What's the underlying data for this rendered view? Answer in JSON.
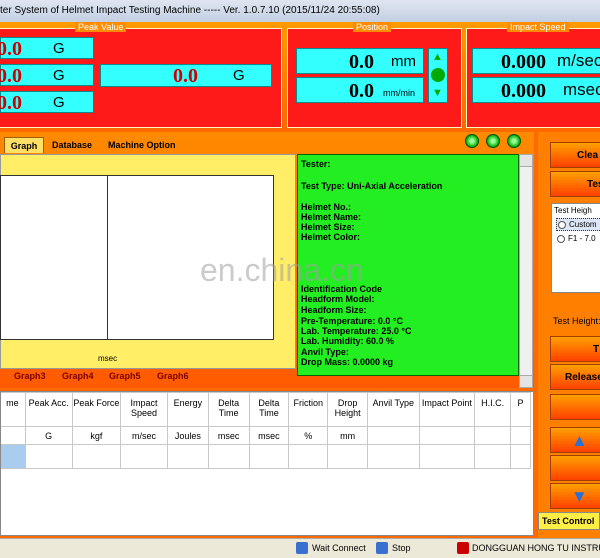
{
  "window": {
    "title": "ter System of Helmet Impact Testing Machine ----- Ver. 1.0.7.10 (2015/11/24 20:55:08)"
  },
  "peak": {
    "label": "Peak Value",
    "rows": [
      {
        "value": "0.0",
        "unit": "G"
      },
      {
        "value": "0.0",
        "unit": "G"
      },
      {
        "value": "0.0",
        "unit": "G"
      }
    ],
    "main": {
      "value": "0.0",
      "unit": "G"
    }
  },
  "position": {
    "label": "Position",
    "pos": {
      "value": "0.0",
      "unit": "mm"
    },
    "speed": {
      "value": "0.0",
      "unit": "mm/min"
    }
  },
  "impact_speed": {
    "label": "Impact Speed",
    "speed": {
      "value": "0.000",
      "unit": "m/sec"
    },
    "time": {
      "value": "0.000",
      "unit": "msec"
    }
  },
  "tabs": [
    "Graph",
    "Database",
    "Machine Option"
  ],
  "graph": {
    "xlabel": "msec"
  },
  "graph_tabs": [
    "Graph3",
    "Graph4",
    "Graph5",
    "Graph6"
  ],
  "info": {
    "lines": [
      "Tester:",
      "Test Type: Uni-Axial Acceleration",
      "Helmet No.:",
      "Helmet Name:",
      "Helmet Size:",
      "Helmet Color:",
      "Identification Code",
      "Headform Model:",
      "Headform Size:",
      "Pre-Temperature: 0.0 °C",
      "Lab. Temperature: 25.0 °C",
      "Lab. Humidity: 60.0 %",
      "Anvil Type:",
      "Drop Mass: 0.0000 kg"
    ]
  },
  "table": {
    "headers": [
      "me",
      "Peak Acc.",
      "Peak Force",
      "Impact Speed",
      "Energy",
      "Delta Time",
      "Delta Time",
      "Friction",
      "Drop Height",
      "Anvil Type",
      "Impact Point",
      "H.I.C.",
      "P"
    ],
    "units": [
      "",
      "G",
      "kgf",
      "m/sec",
      "Joules",
      "msec",
      "msec",
      "%",
      "mm",
      "",
      "",
      "",
      ""
    ]
  },
  "right": {
    "clear_label": "Clea",
    "test_label": "Tes",
    "test_height_label": "Test Heigh",
    "option_custom": "Custom",
    "option_f1": "F1 - 7.0",
    "test_height_caption": "Test Height:",
    "t_label": "T",
    "release_label": "Release",
    "test_control_label": "Test Control"
  },
  "status": {
    "wait_connect": "Wait Connect",
    "stop": "Stop",
    "company": "DONGGUAN HONG TU INSTRU"
  },
  "watermark": "en.china.cn",
  "colors": {
    "accent": "#ff6a00",
    "display_bg": "#33ffff",
    "info_bg": "#22ee22"
  }
}
